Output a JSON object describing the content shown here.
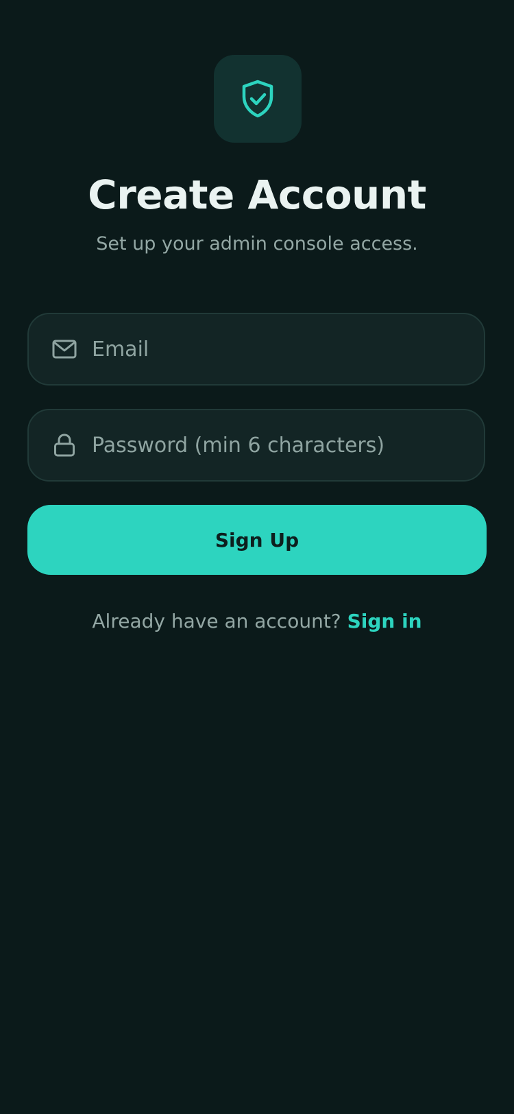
{
  "header": {
    "logo_icon": "shield-check-icon",
    "title": "Create Account",
    "subtitle": "Set up your admin console access."
  },
  "form": {
    "email": {
      "icon": "mail-icon",
      "placeholder": "Email",
      "value": ""
    },
    "password": {
      "icon": "lock-icon",
      "placeholder": "Password (min 6 characters)",
      "value": ""
    },
    "submit_label": "Sign Up"
  },
  "footer": {
    "prompt": "Already have an account?",
    "link_label": "Sign in"
  },
  "colors": {
    "background": "#0b1a1a",
    "accent": "#2dd4bf",
    "field_background": "#132525",
    "logo_tile": "#123230",
    "text_primary": "#eaf3f1",
    "text_muted": "#93a7a4"
  }
}
